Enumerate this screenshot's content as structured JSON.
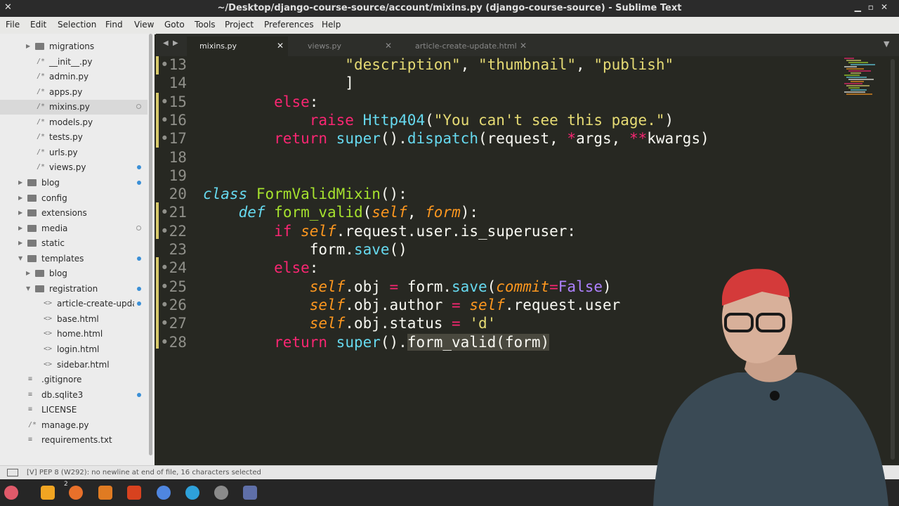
{
  "window": {
    "title": "~/Desktop/django-course-source/account/mixins.py (django-course-source) - Sublime Text"
  },
  "menu": [
    "File",
    "Edit",
    "Selection",
    "Find",
    "View",
    "Goto",
    "Tools",
    "Project",
    "Preferences",
    "Help"
  ],
  "sidebar": {
    "items": [
      {
        "label": "migrations",
        "type": "folder",
        "expanded": false
      },
      {
        "label": "__init__.py",
        "type": "file"
      },
      {
        "label": "admin.py",
        "type": "file"
      },
      {
        "label": "apps.py",
        "type": "file"
      },
      {
        "label": "mixins.py",
        "type": "file",
        "selected": true,
        "marker": "open-circle"
      },
      {
        "label": "models.py",
        "type": "file"
      },
      {
        "label": "tests.py",
        "type": "file"
      },
      {
        "label": "urls.py",
        "type": "file"
      },
      {
        "label": "views.py",
        "type": "file",
        "marker": "dot"
      },
      {
        "label": "blog",
        "type": "folder",
        "expanded": false,
        "marker": "dot"
      },
      {
        "label": "config",
        "type": "folder",
        "expanded": false
      },
      {
        "label": "extensions",
        "type": "folder",
        "expanded": false
      },
      {
        "label": "media",
        "type": "folder",
        "expanded": false,
        "marker": "open-circle"
      },
      {
        "label": "static",
        "type": "folder",
        "expanded": false
      },
      {
        "label": "templates",
        "type": "folder",
        "expanded": true,
        "marker": "dot"
      },
      {
        "label": "blog",
        "type": "folder",
        "expanded": false
      },
      {
        "label": "registration",
        "type": "folder",
        "expanded": true,
        "marker": "dot"
      },
      {
        "label": "article-create-update.html",
        "type": "html",
        "marker": "dot"
      },
      {
        "label": "base.html",
        "type": "html"
      },
      {
        "label": "home.html",
        "type": "html"
      },
      {
        "label": "login.html",
        "type": "html"
      },
      {
        "label": "sidebar.html",
        "type": "html"
      },
      {
        "label": ".gitignore",
        "type": "plain"
      },
      {
        "label": "db.sqlite3",
        "type": "plain",
        "marker": "dot"
      },
      {
        "label": "LICENSE",
        "type": "plain"
      },
      {
        "label": "manage.py",
        "type": "file"
      },
      {
        "label": "requirements.txt",
        "type": "plain"
      }
    ]
  },
  "tabs": [
    {
      "label": "mixins.py",
      "active": true
    },
    {
      "label": "views.py",
      "active": false
    },
    {
      "label": "article-create-update.html",
      "active": false
    }
  ],
  "editor": {
    "lines": [
      {
        "num": "13",
        "modified": true,
        "tokens": [
          [
            "                ",
            ""
          ],
          [
            "\"description\"",
            "str"
          ],
          [
            ", ",
            ""
          ],
          [
            "\"thumbnail\"",
            "str"
          ],
          [
            ", ",
            ""
          ],
          [
            "\"publish\"",
            "str"
          ]
        ]
      },
      {
        "num": "14",
        "modified": false,
        "tokens": [
          [
            "                ]",
            ""
          ]
        ]
      },
      {
        "num": "15",
        "modified": true,
        "tokens": [
          [
            "        ",
            ""
          ],
          [
            "else",
            "kw"
          ],
          [
            ":",
            ""
          ]
        ]
      },
      {
        "num": "16",
        "modified": true,
        "tokens": [
          [
            "            ",
            ""
          ],
          [
            "raise",
            "kw"
          ],
          [
            " ",
            ""
          ],
          [
            "Http404",
            "bi"
          ],
          [
            "(",
            ""
          ],
          [
            "\"You can't see this page.\"",
            "str"
          ],
          [
            ")",
            ""
          ]
        ]
      },
      {
        "num": "17",
        "modified": true,
        "tokens": [
          [
            "        ",
            ""
          ],
          [
            "return",
            "kw"
          ],
          [
            " ",
            ""
          ],
          [
            "super",
            "bi"
          ],
          [
            "().",
            ""
          ],
          [
            "dispatch",
            "bi"
          ],
          [
            "(request, ",
            ""
          ],
          [
            "*",
            "kw"
          ],
          [
            "args, ",
            ""
          ],
          [
            "**",
            "kw"
          ],
          [
            "kwargs)",
            ""
          ]
        ]
      },
      {
        "num": "18",
        "modified": false,
        "tokens": []
      },
      {
        "num": "19",
        "modified": false,
        "tokens": []
      },
      {
        "num": "20",
        "modified": false,
        "tokens": [
          [
            "class",
            "kwb"
          ],
          [
            " ",
            ""
          ],
          [
            "FormValidMixin",
            "fn"
          ],
          [
            "():",
            ""
          ]
        ]
      },
      {
        "num": "21",
        "modified": true,
        "tokens": [
          [
            "    ",
            ""
          ],
          [
            "def",
            "kwb"
          ],
          [
            " ",
            ""
          ],
          [
            "form_valid",
            "fn"
          ],
          [
            "(",
            ""
          ],
          [
            "self",
            "param"
          ],
          [
            ", ",
            ""
          ],
          [
            "form",
            "param"
          ],
          [
            "):",
            ""
          ]
        ]
      },
      {
        "num": "22",
        "modified": true,
        "tokens": [
          [
            "        ",
            ""
          ],
          [
            "if",
            "kw"
          ],
          [
            " ",
            ""
          ],
          [
            "self",
            "self"
          ],
          [
            ".request.user.is_superuser:",
            ""
          ]
        ]
      },
      {
        "num": "23",
        "modified": false,
        "tokens": [
          [
            "            form.",
            ""
          ],
          [
            "save",
            "bi"
          ],
          [
            "()",
            ""
          ]
        ]
      },
      {
        "num": "24",
        "modified": true,
        "tokens": [
          [
            "        ",
            ""
          ],
          [
            "else",
            "kw"
          ],
          [
            ":",
            ""
          ]
        ]
      },
      {
        "num": "25",
        "modified": true,
        "tokens": [
          [
            "            ",
            ""
          ],
          [
            "self",
            "self"
          ],
          [
            ".obj ",
            ""
          ],
          [
            "=",
            "kw"
          ],
          [
            " form.",
            ""
          ],
          [
            "save",
            "bi"
          ],
          [
            "(",
            ""
          ],
          [
            "commit",
            "param"
          ],
          [
            "=",
            "kw"
          ],
          [
            "False",
            "const"
          ],
          [
            ")",
            ""
          ]
        ]
      },
      {
        "num": "26",
        "modified": true,
        "tokens": [
          [
            "            ",
            ""
          ],
          [
            "self",
            "self"
          ],
          [
            ".obj.author ",
            ""
          ],
          [
            "=",
            "kw"
          ],
          [
            " ",
            ""
          ],
          [
            "self",
            "self"
          ],
          [
            ".request.user",
            ""
          ]
        ]
      },
      {
        "num": "27",
        "modified": true,
        "tokens": [
          [
            "            ",
            ""
          ],
          [
            "self",
            "self"
          ],
          [
            ".obj.status ",
            ""
          ],
          [
            "=",
            "kw"
          ],
          [
            " ",
            ""
          ],
          [
            "'d'",
            "str"
          ]
        ]
      },
      {
        "num": "28",
        "modified": true,
        "tokens": [
          [
            "        ",
            ""
          ],
          [
            "return",
            "kw"
          ],
          [
            " ",
            ""
          ],
          [
            "super",
            "bi"
          ],
          [
            "().",
            ""
          ],
          [
            "form_valid(form)",
            "sel-hl"
          ]
        ]
      }
    ]
  },
  "status": {
    "text": "[V] PEP 8 (W292): no newline at end of file, 16 characters selected"
  },
  "taskbar": {
    "badge": "2"
  },
  "colors": {
    "editor_bg": "#272822",
    "sidebar_bg": "#ececec",
    "accent": "#3a8fd6"
  }
}
